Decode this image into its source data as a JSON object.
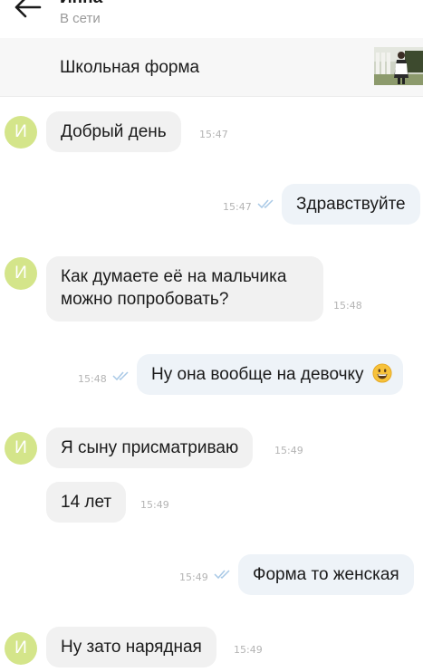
{
  "header": {
    "contact_name": "Инна",
    "status": "В сети"
  },
  "product": {
    "title": "Школьная форма"
  },
  "contact_avatar_letter": "И",
  "messages": [
    {
      "direction": "in",
      "text": "Добрый день",
      "time": "15:47"
    },
    {
      "direction": "out",
      "text": "Здравствуйте",
      "time": "15:47",
      "read": true
    },
    {
      "direction": "in",
      "text_line1": "Как думаете её на мальчика",
      "text_line2": "можно попробовать?",
      "time": "15:48"
    },
    {
      "direction": "out",
      "text": "Ну она вообще на девочку",
      "emoji": "grinning-face",
      "time": "15:48",
      "read": true
    },
    {
      "direction": "in",
      "text": "Я сыну присматриваю",
      "time": "15:49"
    },
    {
      "direction": "in",
      "text": "14 лет",
      "time": "15:49"
    },
    {
      "direction": "out",
      "text": "Форма то женская",
      "time": "15:49",
      "read": true
    },
    {
      "direction": "in",
      "text": "Ну зато нарядная",
      "time": "15:49"
    }
  ],
  "colors": {
    "avatar": "#d4e58a",
    "incoming_bubble": "#f1f1f1",
    "outgoing_bubble": "#eef3f8",
    "read_ticks": "#a9c9e6"
  }
}
